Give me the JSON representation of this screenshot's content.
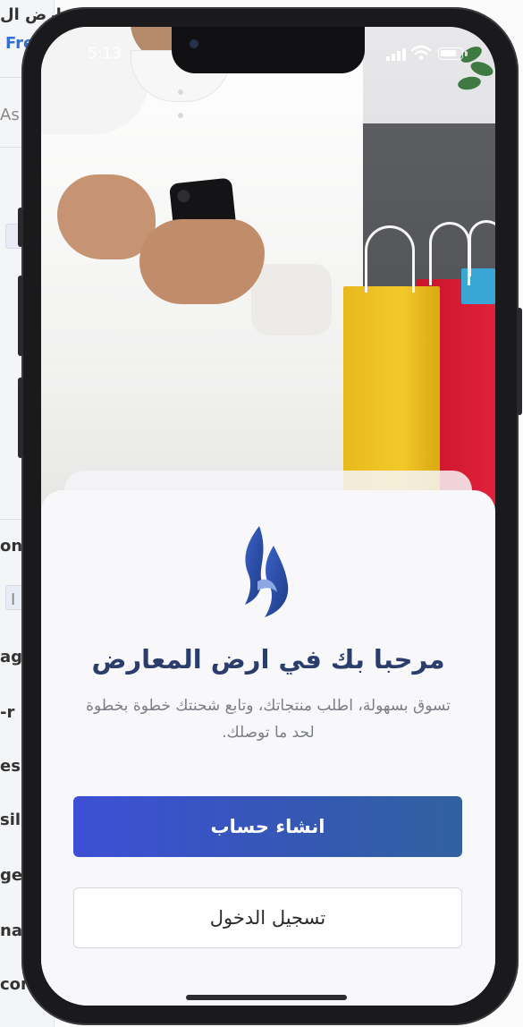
{
  "background_app": {
    "fragments": [
      "ارض ال",
      "Fre",
      "As",
      "I",
      "on",
      "ag",
      "-r",
      "es",
      "sil:",
      "ge",
      "na",
      "con:"
    ]
  },
  "status_bar": {
    "time": "5:13",
    "signal_icon": "cellular-signal-icon",
    "wifi_icon": "wifi-icon",
    "battery_icon": "battery-icon",
    "battery_level": 0.8
  },
  "hero": {
    "image": "man-in-white-thobe-holding-phone-with-shopping-bags"
  },
  "welcome": {
    "logo_icon": "brand-flame-logo-icon",
    "title": "مرحبا بك في ارض المعارض",
    "subtitle": "تسوق بسهولة، اطلب منتجاتك، وتابع شحنتك خطوة بخطوة لحد ما توصلك."
  },
  "actions": {
    "create_account_label": "انشاء حساب",
    "login_label": "تسجيل الدخول"
  },
  "colors": {
    "title": "#2b3e6b",
    "primary_button_start": "#3d4fd6",
    "primary_button_end": "#31619f",
    "subtitle": "#7a7d85",
    "sheet_background": "#f8f8fa"
  }
}
